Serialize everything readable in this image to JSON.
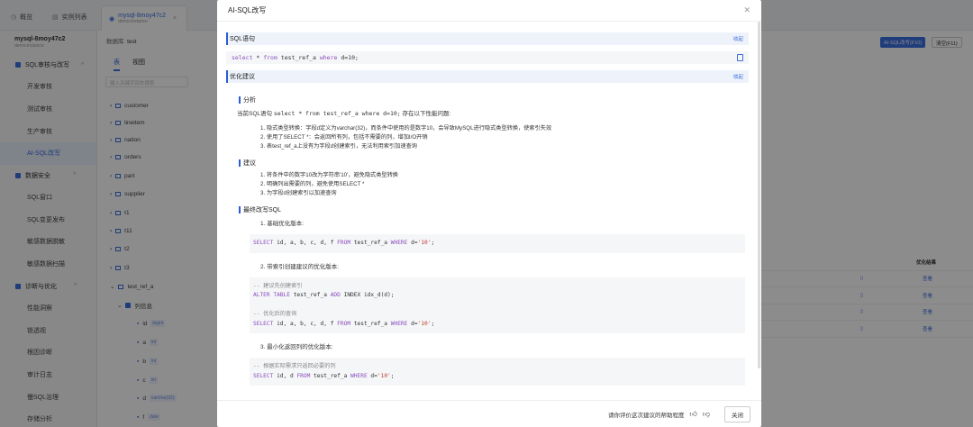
{
  "app": {
    "tabs": [
      {
        "label": "概览"
      },
      {
        "label": "实例列表"
      },
      {
        "label": "mysql-8moy47c2",
        "sub": "demo-instance"
      }
    ],
    "sidebar": {
      "instance": "mysql-8moy47c2",
      "instance_sub": "demo-instance",
      "groups": [
        {
          "label": "SQL审核与改写",
          "items": [
            "开发审核",
            "测试审核",
            "生产审核",
            "AI-SQL改写"
          ]
        },
        {
          "label": "数据安全",
          "items": [
            "SQL窗口",
            "SQL变更发布",
            "敏感数据脱敏",
            "敏感数据扫描"
          ]
        },
        {
          "label": "诊断与优化",
          "items": [
            "性能洞察",
            "锁透视",
            "根因诊断",
            "审计日志",
            "慢SQL治理",
            "存储分析"
          ]
        }
      ],
      "active_item": "AI-SQL改写"
    },
    "db_panel": {
      "db_label": "数据库",
      "db_value": "test",
      "tab_table": "表",
      "tab_view": "视图",
      "search_placeholder": "输入关键字回车搜索",
      "tables": [
        "customer",
        "lineitem",
        "nation",
        "orders",
        "part",
        "supplier",
        "t1",
        "t11",
        "t2",
        "t3",
        "test_ref_a"
      ],
      "column_group": "列信息",
      "columns": [
        {
          "name": "id",
          "type": "bigint"
        },
        {
          "name": "a",
          "type": "int"
        },
        {
          "name": "b",
          "type": "int"
        },
        {
          "name": "c",
          "type": "int"
        },
        {
          "name": "d",
          "type": "varchar(32)"
        },
        {
          "name": "f",
          "type": "date"
        }
      ]
    },
    "right": {
      "ai_button": "AI-SQL改写(F10)",
      "clear_button": "清空(F11)",
      "result_header": "优化结果",
      "result_rows": [
        "查看",
        "查看",
        "查看",
        "查看"
      ]
    }
  },
  "modal": {
    "title": "AI-SQL改写",
    "sql_section": {
      "title": "SQL语句",
      "collapse": "收起",
      "sql": "select * from test_ref_a where d=10;"
    },
    "advice_section": {
      "title": "优化建议",
      "collapse": "收起"
    },
    "analysis": {
      "heading": "分析",
      "intro_prefix": "当前SQL语句",
      "intro_sql": "select * from test_ref_a where d=10;",
      "intro_suffix": "存在以下性能问题:",
      "items": [
        "1. 隐式类型转换：字段d定义为varchar(32)，而条件中使用的是数字10，会导致MySQL进行隐式类型转换，使索引失效",
        "2. 使用了SELECT *：会返回所有列，包括不需要的列，增加I/O开销",
        "3. 表test_ref_a上没有为字段d创建索引，无法利用索引加速查询"
      ]
    },
    "suggest": {
      "heading": "建议",
      "items": [
        "1. 将条件中的数字10改为字符串'10'，避免隐式类型转换",
        "2. 明确列出需要的列，避免使用SELECT *",
        "3. 为字段d创建索引以加速查询"
      ]
    },
    "final": {
      "heading": "最终改写SQL",
      "step1": "1. 基础优化版本:",
      "step1_sql": "SELECT id, a, b, c, d, f FROM test_ref_a WHERE d='10';",
      "step2": "2. 带索引创建建议的优化版本:",
      "step2_c1": "-- 建议先创建索引",
      "step2_sql1": "ALTER TABLE test_ref_a ADD INDEX idx_d(d);",
      "step2_c2": "-- 优化后的查询",
      "step2_sql2": "SELECT id, a, b, c, d, f FROM test_ref_a WHERE d='10';",
      "step3": "3. 最小化返回列的优化版本:",
      "step3_c1": "-- 根据实际需求只返回必要的列",
      "step3_sql": "SELECT id, d FROM test_ref_a WHERE d='10';"
    },
    "footer": {
      "feedback": "请你评价这次建议的帮助程度",
      "close": "关闭"
    }
  },
  "colors": {
    "accent": "#2b5cd6",
    "keyword": "#8a4dbf",
    "string": "#c0392b"
  }
}
